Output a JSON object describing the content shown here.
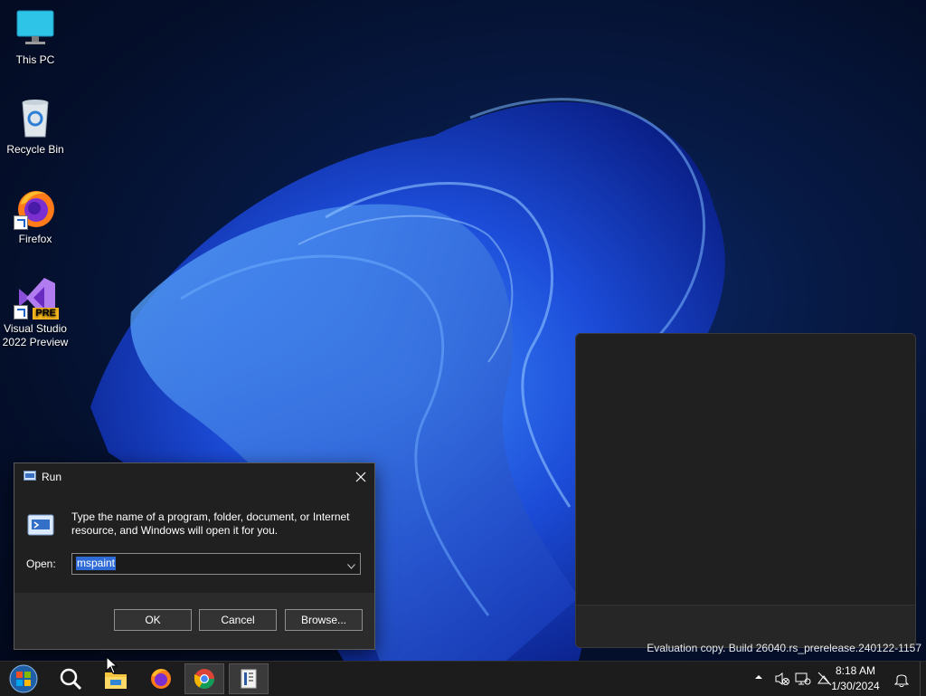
{
  "desktop": {
    "icons": [
      {
        "label": "This PC"
      },
      {
        "label": "Recycle Bin"
      },
      {
        "label": "Firefox"
      },
      {
        "label": "Visual Studio 2022 Preview",
        "badge": "PRE"
      }
    ],
    "watermark": "Evaluation copy. Build 26040.rs_prerelease.240122-1157"
  },
  "run_dialog": {
    "title": "Run",
    "description": "Type the name of a program, folder, document, or Internet resource, and Windows will open it for you.",
    "open_label": "Open:",
    "open_value": "mspaint",
    "ok_label": "OK",
    "cancel_label": "Cancel",
    "browse_label": "Browse..."
  },
  "taskbar": {
    "items": [
      "start-orb-icon",
      "search-icon",
      "file-explorer-icon",
      "firefox-icon",
      "chrome-icon",
      "run-app-icon"
    ],
    "time": "8:18 AM",
    "date": "1/30/2024"
  },
  "colors": {
    "accent": "#2f6cd8",
    "dialog_bg": "#202020",
    "taskbar_bg": "#1c1c1c"
  }
}
